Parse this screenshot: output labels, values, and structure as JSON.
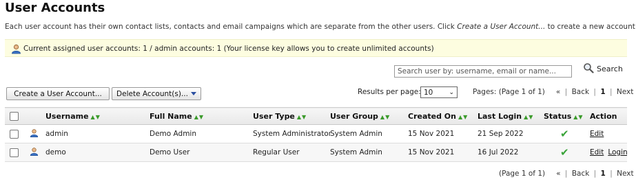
{
  "page": {
    "title": "User Accounts",
    "description_pre": "Each user account has their own contact lists, contacts and email campaigns which are separate from the other users. Click ",
    "description_link": "Create a User Account...",
    "description_post": " to create a new account."
  },
  "notice": {
    "text": "Current assigned user accounts: 1 / admin accounts: 1 (Your license key allows you to create unlimited accounts)"
  },
  "search": {
    "placeholder": "Search user by: username, email or name...",
    "button_label": "Search"
  },
  "toolbar": {
    "create_label": "Create a User Account...",
    "delete_label": "Delete Account(s)..."
  },
  "results_per_page": {
    "label": "Results per page:",
    "value": "10"
  },
  "pager_top": {
    "pages_text": "Pages: (Page 1 of 1)",
    "first": "«",
    "back": "Back",
    "current": "1",
    "next": "Next",
    "last": "»"
  },
  "pager_bottom": {
    "pages_text": "(Page 1 of 1)",
    "first": "«",
    "back": "Back",
    "current": "1",
    "next": "Next",
    "last": "»"
  },
  "table": {
    "columns": {
      "username": "Username",
      "full_name": "Full Name",
      "user_type": "User Type",
      "user_group": "User Group",
      "created_on": "Created On",
      "last_login": "Last Login",
      "status": "Status",
      "action": "Action"
    },
    "rows": [
      {
        "username": "admin",
        "full_name": "Demo Admin",
        "user_type": "System Administrator",
        "user_group": "System Admin",
        "created_on": "15 Nov 2021",
        "last_login": "21 Sep 2022",
        "status": "active",
        "actions": [
          "Edit"
        ]
      },
      {
        "username": "demo",
        "full_name": "Demo User",
        "user_type": "Regular User",
        "user_group": "System Admin",
        "created_on": "15 Nov 2021",
        "last_login": "16 Jul 2022",
        "status": "active",
        "actions": [
          "Edit",
          "Login"
        ]
      }
    ]
  },
  "colors": {
    "notice_bg": "#fdfde0",
    "sort_arrows": "#3a9a2a",
    "status_check": "#3aa43a",
    "caret": "#2b4fa0"
  }
}
